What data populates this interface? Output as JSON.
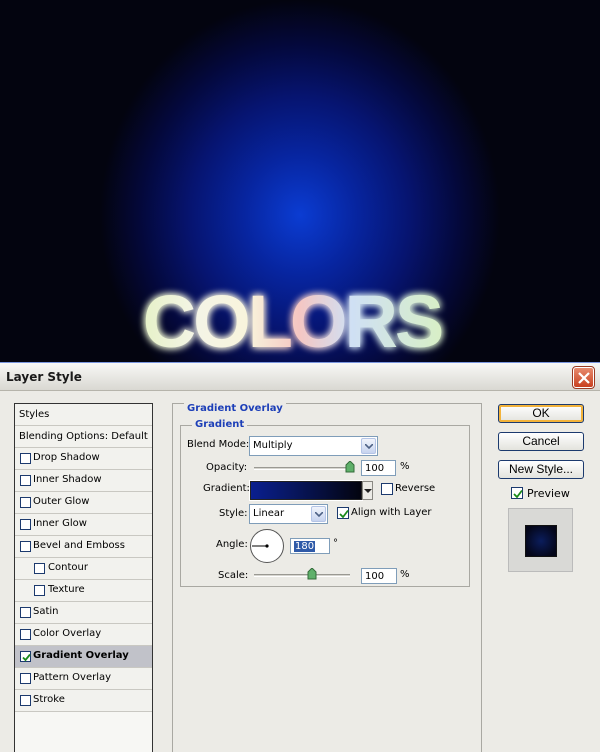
{
  "canvas": {
    "headline": "COLORS"
  },
  "dialog": {
    "title": "Layer Style",
    "styles_list": [
      {
        "label": "Styles",
        "kind": "header"
      },
      {
        "label": "Blending Options: Default",
        "kind": "header"
      },
      {
        "label": "Drop Shadow",
        "checked": false
      },
      {
        "label": "Inner Shadow",
        "checked": false
      },
      {
        "label": "Outer Glow",
        "checked": false
      },
      {
        "label": "Inner Glow",
        "checked": false
      },
      {
        "label": "Bevel and Emboss",
        "checked": false
      },
      {
        "label": "Contour",
        "checked": false,
        "sub": true
      },
      {
        "label": "Texture",
        "checked": false,
        "sub": true
      },
      {
        "label": "Satin",
        "checked": false
      },
      {
        "label": "Color Overlay",
        "checked": false
      },
      {
        "label": "Gradient Overlay",
        "checked": true,
        "selected": true
      },
      {
        "label": "Pattern Overlay",
        "checked": false
      },
      {
        "label": "Stroke",
        "checked": false
      }
    ],
    "group_title": "Gradient Overlay",
    "subgroup_title": "Gradient",
    "blend_mode": {
      "label": "Blend Mode:",
      "value": "Multiply"
    },
    "opacity": {
      "label": "Opacity:",
      "value": "100",
      "unit": "%",
      "level": 1.0
    },
    "gradient": {
      "label": "Gradient:",
      "reverse_label": "Reverse",
      "reverse_checked": false
    },
    "style": {
      "label": "Style:",
      "value": "Linear",
      "align_label": "Align with Layer",
      "align_checked": true
    },
    "angle": {
      "label": "Angle:",
      "value": "180",
      "unit": "°"
    },
    "scale": {
      "label": "Scale:",
      "value": "100",
      "unit": "%",
      "level": 0.6
    },
    "buttons": {
      "ok": "OK",
      "cancel": "Cancel",
      "new_style": "New Style..."
    },
    "preview": {
      "label": "Preview",
      "checked": true
    }
  }
}
